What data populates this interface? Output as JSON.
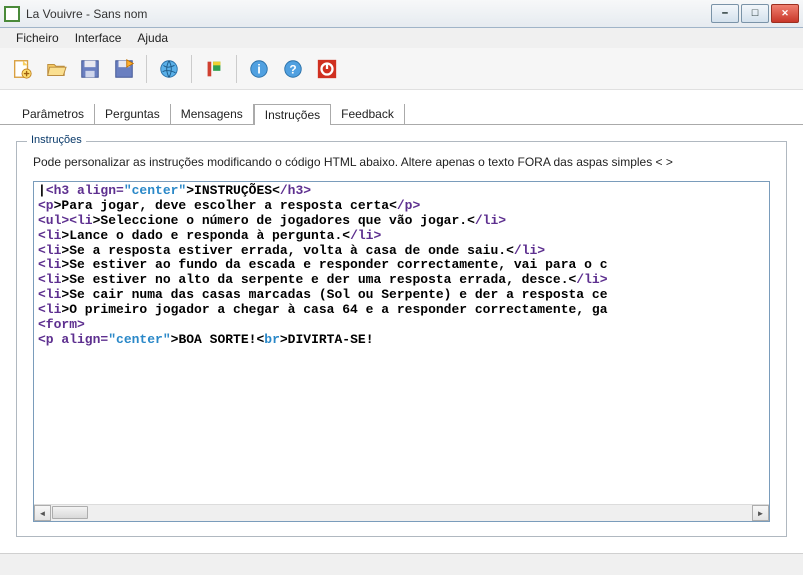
{
  "titlebar": {
    "title": "La Vouivre - Sans nom"
  },
  "menu": {
    "file": "Ficheiro",
    "interface": "Interface",
    "help": "Ajuda"
  },
  "tabs": {
    "params": "Parâmetros",
    "questions": "Perguntas",
    "messages": "Mensagens",
    "instructions": "Instruções",
    "feedback": "Feedback"
  },
  "fieldset": {
    "legend": "Instruções",
    "desc": "Pode personalizar as instruções modificando o código HTML abaixo. Altere apenas o texto FORA das aspas simples < >"
  },
  "code": {
    "l1_tag_o": "<h3",
    "l1_attr": " align=",
    "l1_val": "\"center\"",
    "l1_txt": ">INSTRUÇÕES<",
    "l1_tag_c": "/h3>",
    "l2_tag_o": "<p",
    "l2_txt": ">Para jogar, deve escolher a resposta certa<",
    "l2_tag_c": "/p>",
    "l3_tag_o": "<ul><li",
    "l3_txt": ">Seleccione o número de jogadores que vão jogar.<",
    "l3_tag_c": "/li>",
    "l4_tag_o": "<li",
    "l4_txt": ">Lance o dado e responda à pergunta.<",
    "l4_tag_c": "/li>",
    "l5_tag_o": "<li",
    "l5_txt": ">Se a resposta estiver errada, volta à casa de onde saiu.<",
    "l5_tag_c": "/li>",
    "l6_tag_o": "<li",
    "l6_txt": ">Se estiver ao fundo da escada e responder correctamente, vai para o c",
    "l7_tag_o": "<li",
    "l7_txt": ">Se estiver no alto da serpente e der uma resposta errada, desce.<",
    "l7_tag_c": "/li>",
    "l8_tag_o": "<li",
    "l8_txt": ">Se cair numa das casas marcadas (Sol ou Serpente) e der a resposta ce",
    "l9_tag_o": "<li",
    "l9_txt": ">O primeiro jogador a chegar à casa 64 e a responder correctamente, ga",
    "l10_tag_o": "<form>",
    "l11_tag_o": "<p ",
    "l11_attr": "align=",
    "l11_val": "\"center\"",
    "l11_txt": ">BOA SORTE!<",
    "l11_br": "br",
    "l11_txt2": ">DIVIRTA-SE!"
  }
}
